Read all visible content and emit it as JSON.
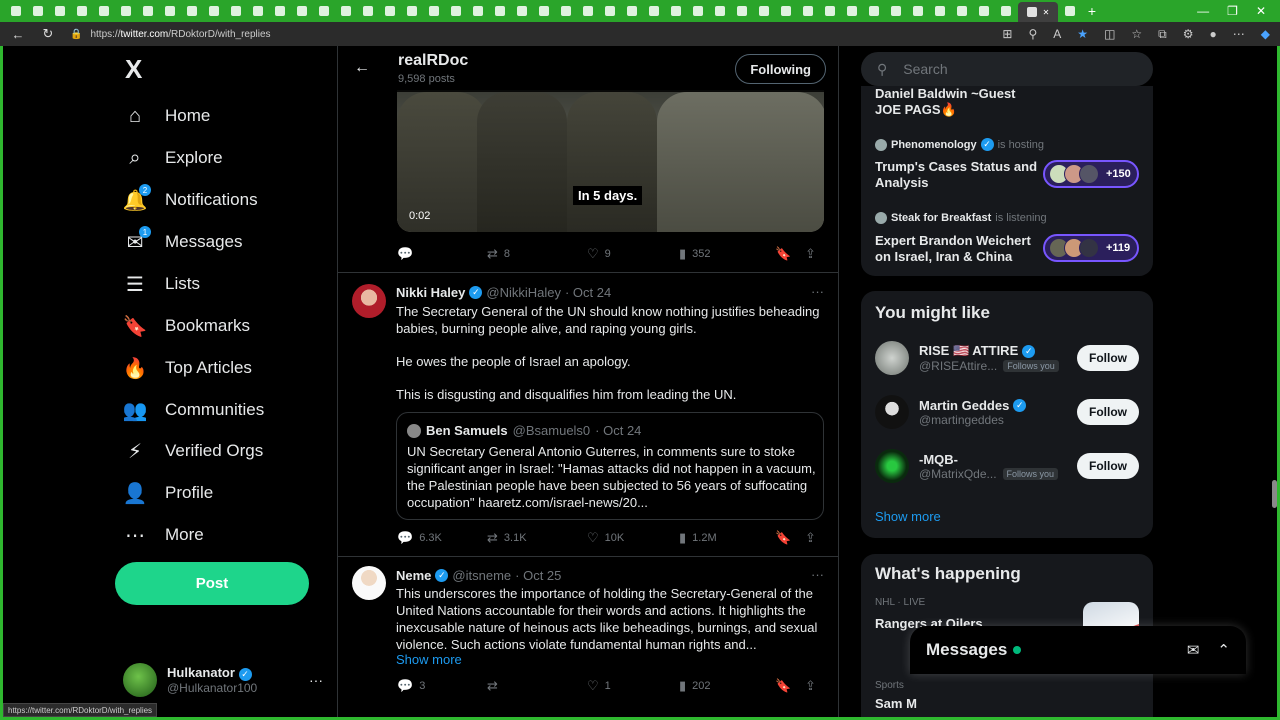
{
  "browser": {
    "url_prefix": "https://",
    "url_domain": "twitter.com",
    "url_path": "/RDoktorD/with_replies",
    "status_url": "https://twitter.com/RDoktorD/with_replies"
  },
  "sidebar": {
    "logo": "X",
    "items": [
      {
        "label": "Home",
        "icon": "⌂"
      },
      {
        "label": "Explore",
        "icon": "⌕"
      },
      {
        "label": "Notifications",
        "icon": "🔔",
        "badge": "2"
      },
      {
        "label": "Messages",
        "icon": "✉",
        "badge": "1"
      },
      {
        "label": "Lists",
        "icon": "☰"
      },
      {
        "label": "Bookmarks",
        "icon": "🔖"
      },
      {
        "label": "Top Articles",
        "icon": "🔥"
      },
      {
        "label": "Communities",
        "icon": "👥"
      },
      {
        "label": "Verified Orgs",
        "icon": "⚡"
      },
      {
        "label": "Profile",
        "icon": "👤"
      },
      {
        "label": "More",
        "icon": "⋯"
      }
    ],
    "post_label": "Post",
    "me": {
      "name": "Hulkanator",
      "handle": "@Hulkanator100"
    }
  },
  "header": {
    "name": "realRDoc",
    "posts": "9,598 posts",
    "following_label": "Following"
  },
  "video": {
    "caption": "In 5 days.",
    "time": "0:02"
  },
  "tweets": [
    {
      "replies": "",
      "retweets": "8",
      "likes": "9",
      "views": "352"
    },
    {
      "name": "Nikki Haley",
      "handle": "@NikkiHaley",
      "date": "· Oct 24",
      "p1": "The Secretary General of the UN should know nothing justifies beheading babies, burning people alive, and raping young girls.",
      "p2": "He owes the people of Israel an apology.",
      "p3": "This is disgusting and disqualifies him from leading the UN.",
      "quote": {
        "name": "Ben Samuels",
        "handle": "@Bsamuels0",
        "date": "· Oct 24",
        "text": "UN Secretary General Antonio Guterres, in comments sure to stoke significant anger in Israel: \"Hamas attacks did not happen in a vacuum, the Palestinian people have been subjected to 56 years of suffocating occupation\" haaretz.com/israel-news/20..."
      },
      "replies": "6.3K",
      "retweets": "3.1K",
      "likes": "10K",
      "views": "1.2M"
    },
    {
      "name": "Neme",
      "handle": "@itsneme",
      "date": "· Oct 25",
      "text": "This underscores the importance of holding the Secretary-General of the United Nations accountable for their words and actions. It highlights the inexcusable nature of heinous acts like beheadings, burnings, and sexual violence. Such actions violate fundamental human rights and...",
      "show_more": "Show more",
      "replies": "3",
      "retweets": "",
      "likes": "1",
      "views": "202"
    }
  ],
  "right": {
    "search_placeholder": "Search",
    "spaces": [
      {
        "title": "Daniel Baldwin ~Guest JOE PAGS🔥"
      },
      {
        "host": "Phenomenology",
        "role": "is hosting",
        "title": "Trump's Cases Status and Analysis",
        "count": "+150"
      },
      {
        "host": "Steak for Breakfast",
        "role": "is listening",
        "title": "Expert Brandon Weichert on Israel, Iran & China",
        "count": "+119"
      }
    ],
    "you_might_like": {
      "title": "You might like",
      "follow_label": "Follow",
      "follows_you": "Follows you",
      "users": [
        {
          "name": "RISE 🇺🇸 ATTIRE",
          "handle": "@RISEAttire...",
          "follows_you": true
        },
        {
          "name": "Martin Geddes",
          "handle": "@martingeddes",
          "follows_you": false
        },
        {
          "name": "-MQB-",
          "handle": "@MatrixQde...",
          "follows_you": true
        }
      ],
      "show_more": "Show more"
    },
    "whats_happening": {
      "title": "What's happening",
      "trends": [
        {
          "meta": "NHL · LIVE",
          "name": "Rangers at Oilers"
        },
        {
          "meta": "Sports",
          "name": "Sam M"
        }
      ]
    }
  },
  "messages_drawer": {
    "title": "Messages"
  }
}
